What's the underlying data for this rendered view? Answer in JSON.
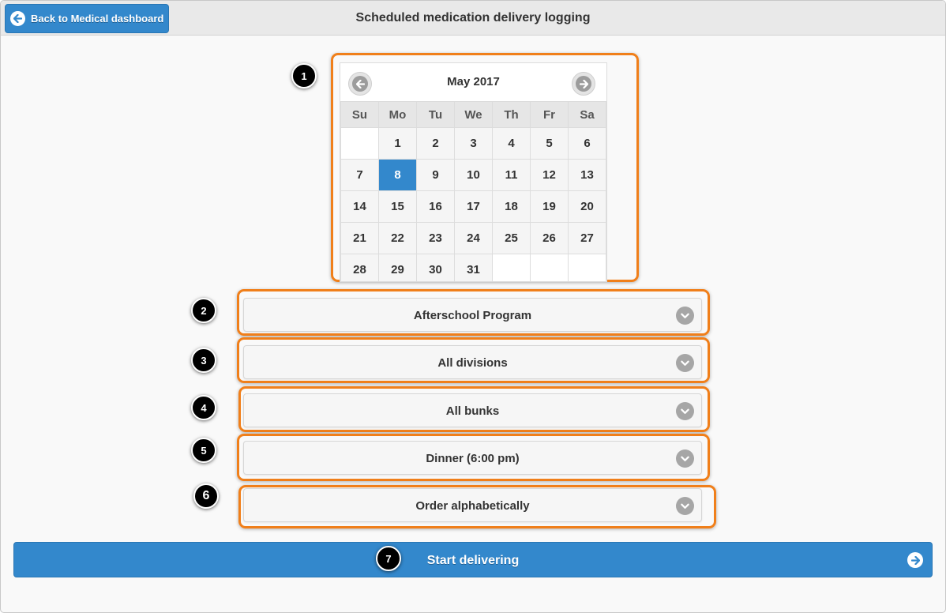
{
  "header": {
    "back_label": "Back to Medical dashboard",
    "title": "Scheduled medication delivery logging"
  },
  "calendar": {
    "month_label": "May 2017",
    "weekdays": [
      "Su",
      "Mo",
      "Tu",
      "We",
      "Th",
      "Fr",
      "Sa"
    ],
    "weeks": [
      [
        "",
        "1",
        "2",
        "3",
        "4",
        "5",
        "6"
      ],
      [
        "7",
        "8",
        "9",
        "10",
        "11",
        "12",
        "13"
      ],
      [
        "14",
        "15",
        "16",
        "17",
        "18",
        "19",
        "20"
      ],
      [
        "21",
        "22",
        "23",
        "24",
        "25",
        "26",
        "27"
      ],
      [
        "28",
        "29",
        "30",
        "31",
        "",
        "",
        ""
      ]
    ],
    "selected_day": "8"
  },
  "selects": [
    {
      "value": "Afterschool Program"
    },
    {
      "value": "All divisions"
    },
    {
      "value": "All bunks"
    },
    {
      "value": "Dinner (6:00 pm)"
    },
    {
      "value": "Order alphabetically"
    }
  ],
  "start_label": "Start delivering",
  "badges": [
    "1",
    "2",
    "3",
    "4",
    "5",
    "6",
    "7"
  ],
  "colors": {
    "accent": "#3388cc",
    "highlight": "#f07f1a"
  },
  "icons": {
    "back": "arrow-left-icon",
    "prev": "arrow-left-icon",
    "next": "arrow-right-icon",
    "select": "chevron-down-icon",
    "start": "arrow-right-icon"
  }
}
